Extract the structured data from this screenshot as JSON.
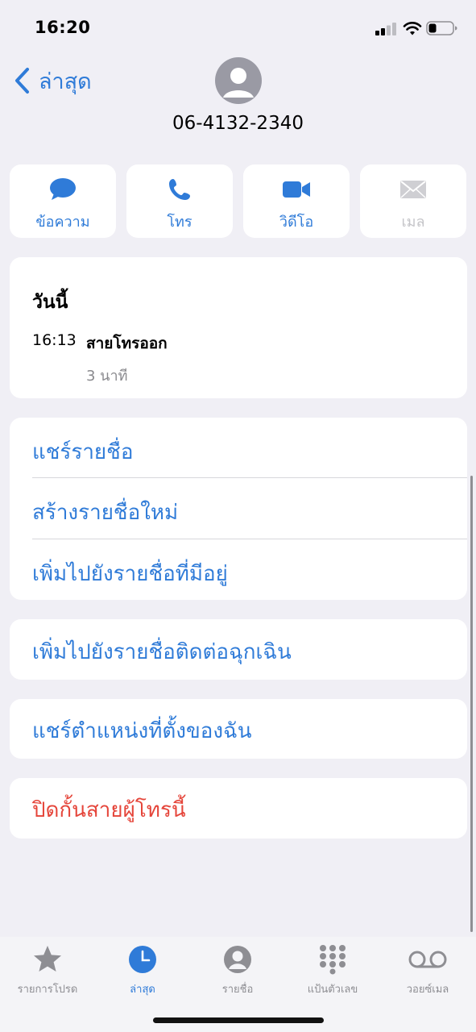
{
  "status": {
    "time": "16:20"
  },
  "nav": {
    "back_label": "ล่าสุด"
  },
  "contact": {
    "phone": "06-4132-2340",
    "avatar_icon": "person-icon"
  },
  "actions": [
    {
      "label": "ข้อความ",
      "icon": "message-icon",
      "enabled": true
    },
    {
      "label": "โทร",
      "icon": "phone-icon",
      "enabled": true
    },
    {
      "label": "วิดีโอ",
      "icon": "video-icon",
      "enabled": true
    },
    {
      "label": "เมล",
      "icon": "mail-icon",
      "enabled": false
    }
  ],
  "history": {
    "title": "วันนี้",
    "time": "16:13",
    "type": "สายโทรออก",
    "duration": "3 นาที"
  },
  "options": {
    "share_contact": "แชร์รายชื่อ",
    "create_new_contact": "สร้างรายชื่อใหม่",
    "add_to_existing": "เพิ่มไปยังรายชื่อที่มีอยู่",
    "add_emergency": "เพิ่มไปยังรายชื่อติดต่อฉุกเฉิน",
    "share_location": "แชร์ตำแหน่งที่ตั้งของฉัน",
    "block_caller": "ปิดกั้นสายผู้โทรนี้"
  },
  "tabs": [
    {
      "label": "รายการโปรด",
      "icon": "star-icon"
    },
    {
      "label": "ล่าสุด",
      "icon": "clock-icon",
      "active": true
    },
    {
      "label": "รายชื่อ",
      "icon": "person-circle-icon"
    },
    {
      "label": "แป้นตัวเลข",
      "icon": "keypad-icon"
    },
    {
      "label": "วอยซ์เมล",
      "icon": "voicemail-icon"
    }
  ],
  "colors": {
    "accent": "#2f7bd8",
    "danger": "#e5453a",
    "background": "#f0eff5"
  }
}
